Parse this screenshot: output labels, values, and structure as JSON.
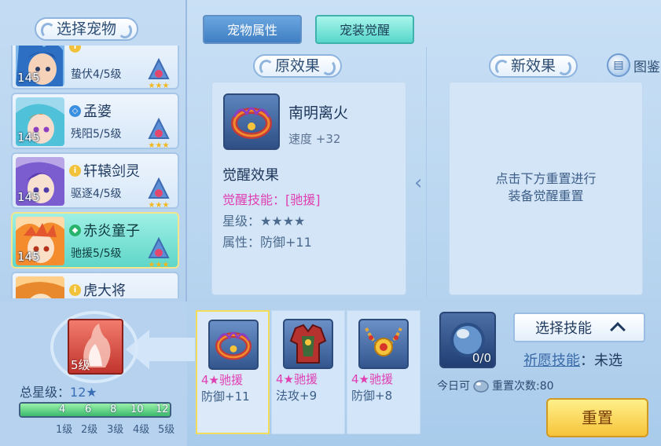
{
  "left_panel": {
    "title": "选择宠物",
    "pets": [
      {
        "name": "",
        "level": "145",
        "skill": "蛰伏4/5级",
        "type_color": "#f3c23b",
        "avatar": "blue-haired-warrior"
      },
      {
        "name": "孟婆",
        "level": "145",
        "skill": "残阳5/5级",
        "type_color": "#3a8fe0",
        "avatar": "cyan-haired-girl"
      },
      {
        "name": "轩辕剑灵",
        "level": "145",
        "skill": "驱逐4/5级",
        "type_color": "#f3c23b",
        "avatar": "purple-haired-girl"
      },
      {
        "name": "赤炎童子",
        "level": "145",
        "skill": "驰援5/5级",
        "type_color": "#27b36a",
        "avatar": "fire-boy",
        "selected": true
      },
      {
        "name": "虎大将",
        "level": "",
        "skill": "",
        "type_color": "#f3c23b",
        "avatar": "tiger-general"
      }
    ]
  },
  "tabs": {
    "attributes": "宠物属性",
    "awakening": "宠装觉醒"
  },
  "original_effect": {
    "title": "原效果",
    "equip_name": "南明离火",
    "equip_base": "速度 +32",
    "awaken_title": "觉醒效果",
    "awaken_skill": "觉醒技能：[驰援]",
    "star_level": "星级：★★★★",
    "attribute": "属性：防御+11"
  },
  "new_effect": {
    "title": "新效果",
    "hint_line1": "点击下方重置进行",
    "hint_line2": "装备觉醒重置"
  },
  "atlas": {
    "label": "图鉴",
    "icon": "book-icon"
  },
  "bottom_left": {
    "slot_level": "5级",
    "total_star_label": "总星级：",
    "total_star_value": "12",
    "star_symbol": "★",
    "progress_fraction": 1.0,
    "bar_ticks": [
      "4",
      "6",
      "8",
      "10",
      "12"
    ],
    "levels": [
      "1级",
      "2级",
      "3级",
      "4级",
      "5级"
    ]
  },
  "candidates": [
    {
      "skill": "4★驰援",
      "attr": "防御+11",
      "icon": "flame-ring-icon",
      "selected": true
    },
    {
      "skill": "4★驰援",
      "attr": "法攻+9",
      "icon": "red-armor-icon",
      "selected": false
    },
    {
      "skill": "4★驰援",
      "attr": "防御+8",
      "icon": "gold-necklace-icon",
      "selected": false
    }
  ],
  "reset_panel": {
    "orb_count": "0/0",
    "select_skill": "选择技能",
    "wish_label": "祈愿技能",
    "wish_value": "未选",
    "reset_prefix": "今日可",
    "reset_suffix": "重置次数:80",
    "reset_button": "重置"
  },
  "colors": {
    "accent_pink": "#e03fb4",
    "selected_teal": "#5fd6c9",
    "reset_gold": "#f6c43a"
  }
}
